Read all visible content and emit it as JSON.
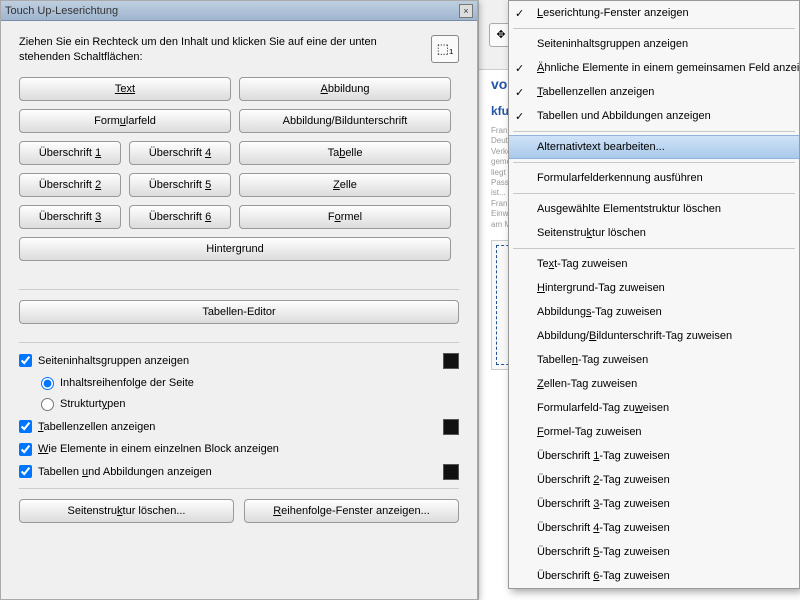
{
  "dialog": {
    "title": "Touch Up-Leserichtung",
    "close_label": "×",
    "instruction": "Ziehen Sie ein Rechteck um den Inhalt und klicken Sie auf eine der unten stehenden Schaltflächen:",
    "rect_icon_glyph": "⬚₁",
    "buttons": {
      "text": "Text",
      "abbildung": "Abbildung",
      "formularfeld": "Formularfeld",
      "abb_bu": "Abbildung/Bildunterschrift",
      "u1": "Überschrift 1",
      "u2": "Überschrift 2",
      "u3": "Überschrift 3",
      "u4": "Überschrift 4",
      "u5": "Überschrift 5",
      "u6": "Überschrift 6",
      "tabelle": "Tabelle",
      "zelle": "Zelle",
      "formel": "Formel",
      "hintergrund": "Hintergrund",
      "tabellen_editor": "Tabellen-Editor",
      "seitenstruktur_loschen": "Seitenstruktur löschen...",
      "reihenfolge_fenster": "Reihenfolge-Fenster anzeigen..."
    },
    "checks": {
      "seiteninhalt": "Seiteninhaltsgruppen anzeigen",
      "reihenfolge": "Inhaltsreihenfolge der Seite",
      "struktur": "Strukturtypen",
      "tabellenzellen": "Tabellenzellen anzeigen",
      "wie_elemente": "Wie Elemente in einem einzelnen Block anzeigen",
      "tab_abb": "Tabellen und Abbildungen anzeigen"
    }
  },
  "doc": {
    "link_text": "voll",
    "heading_frag": "kfurter Air"
  },
  "menu": {
    "items": [
      {
        "label": "Leserichtung-Fenster anzeigen",
        "checked": true,
        "u": "L"
      },
      {
        "sep": true
      },
      {
        "label": "Seiteninhaltsgruppen anzeigen",
        "checked": false,
        "u": ""
      },
      {
        "label": "Ähnliche Elemente in einem gemeinsamen Feld anzeigen",
        "checked": true,
        "u": "Ä"
      },
      {
        "label": "Tabellenzellen anzeigen",
        "checked": true,
        "u": "T"
      },
      {
        "label": "Tabellen und Abbildungen anzeigen",
        "checked": true,
        "u": ""
      },
      {
        "sep": true
      },
      {
        "label": "Alternativtext bearbeiten...",
        "highlight": true,
        "u": ""
      },
      {
        "sep": true
      },
      {
        "label": "Formularfelderkennung ausführen",
        "u": ""
      },
      {
        "sep": true
      },
      {
        "label": "Ausgewählte Elementstruktur löschen",
        "u": ""
      },
      {
        "label": "Seitenstruktur löschen",
        "u": "k"
      },
      {
        "sep": true
      },
      {
        "label": "Text-Tag zuweisen",
        "u": "x"
      },
      {
        "label": "Hintergrund-Tag zuweisen",
        "u": "H"
      },
      {
        "label": "Abbildungs-Tag zuweisen",
        "u": "s"
      },
      {
        "label": "Abbildung/Bildunterschrift-Tag zuweisen",
        "u": "B"
      },
      {
        "label": "Tabellen-Tag zuweisen",
        "u": "n"
      },
      {
        "label": "Zellen-Tag zuweisen",
        "u": "Z"
      },
      {
        "label": "Formularfeld-Tag zuweisen",
        "u": "w"
      },
      {
        "label": "Formel-Tag zuweisen",
        "u": "F"
      },
      {
        "label": "Überschrift 1-Tag zuweisen",
        "u": "1"
      },
      {
        "label": "Überschrift 2-Tag zuweisen",
        "u": "2"
      },
      {
        "label": "Überschrift 3-Tag zuweisen",
        "u": "3"
      },
      {
        "label": "Überschrift 4-Tag zuweisen",
        "u": "4"
      },
      {
        "label": "Überschrift 5-Tag zuweisen",
        "u": "5"
      },
      {
        "label": "Überschrift 6-Tag zuweisen",
        "u": "6"
      }
    ]
  }
}
